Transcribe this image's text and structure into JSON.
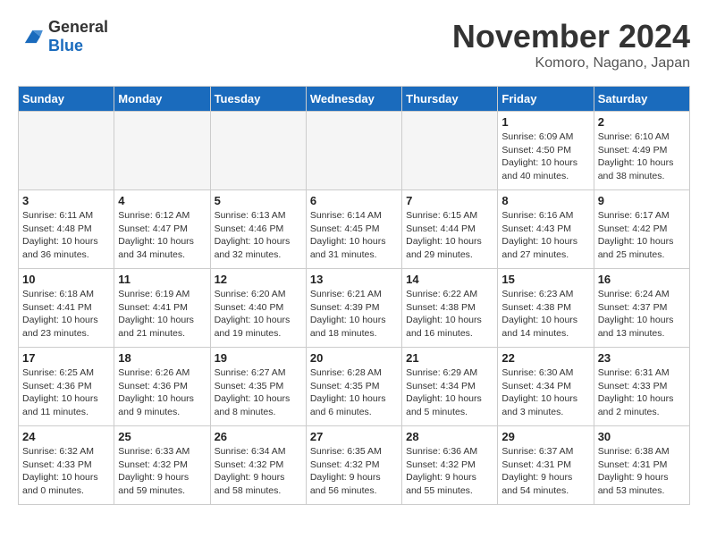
{
  "logo": {
    "general": "General",
    "blue": "Blue"
  },
  "header": {
    "month": "November 2024",
    "location": "Komoro, Nagano, Japan"
  },
  "weekdays": [
    "Sunday",
    "Monday",
    "Tuesday",
    "Wednesday",
    "Thursday",
    "Friday",
    "Saturday"
  ],
  "weeks": [
    [
      {
        "day": "",
        "info": "",
        "empty": true
      },
      {
        "day": "",
        "info": "",
        "empty": true
      },
      {
        "day": "",
        "info": "",
        "empty": true
      },
      {
        "day": "",
        "info": "",
        "empty": true
      },
      {
        "day": "",
        "info": "",
        "empty": true
      },
      {
        "day": "1",
        "info": "Sunrise: 6:09 AM\nSunset: 4:50 PM\nDaylight: 10 hours\nand 40 minutes."
      },
      {
        "day": "2",
        "info": "Sunrise: 6:10 AM\nSunset: 4:49 PM\nDaylight: 10 hours\nand 38 minutes."
      }
    ],
    [
      {
        "day": "3",
        "info": "Sunrise: 6:11 AM\nSunset: 4:48 PM\nDaylight: 10 hours\nand 36 minutes."
      },
      {
        "day": "4",
        "info": "Sunrise: 6:12 AM\nSunset: 4:47 PM\nDaylight: 10 hours\nand 34 minutes."
      },
      {
        "day": "5",
        "info": "Sunrise: 6:13 AM\nSunset: 4:46 PM\nDaylight: 10 hours\nand 32 minutes."
      },
      {
        "day": "6",
        "info": "Sunrise: 6:14 AM\nSunset: 4:45 PM\nDaylight: 10 hours\nand 31 minutes."
      },
      {
        "day": "7",
        "info": "Sunrise: 6:15 AM\nSunset: 4:44 PM\nDaylight: 10 hours\nand 29 minutes."
      },
      {
        "day": "8",
        "info": "Sunrise: 6:16 AM\nSunset: 4:43 PM\nDaylight: 10 hours\nand 27 minutes."
      },
      {
        "day": "9",
        "info": "Sunrise: 6:17 AM\nSunset: 4:42 PM\nDaylight: 10 hours\nand 25 minutes."
      }
    ],
    [
      {
        "day": "10",
        "info": "Sunrise: 6:18 AM\nSunset: 4:41 PM\nDaylight: 10 hours\nand 23 minutes."
      },
      {
        "day": "11",
        "info": "Sunrise: 6:19 AM\nSunset: 4:41 PM\nDaylight: 10 hours\nand 21 minutes."
      },
      {
        "day": "12",
        "info": "Sunrise: 6:20 AM\nSunset: 4:40 PM\nDaylight: 10 hours\nand 19 minutes."
      },
      {
        "day": "13",
        "info": "Sunrise: 6:21 AM\nSunset: 4:39 PM\nDaylight: 10 hours\nand 18 minutes."
      },
      {
        "day": "14",
        "info": "Sunrise: 6:22 AM\nSunset: 4:38 PM\nDaylight: 10 hours\nand 16 minutes."
      },
      {
        "day": "15",
        "info": "Sunrise: 6:23 AM\nSunset: 4:38 PM\nDaylight: 10 hours\nand 14 minutes."
      },
      {
        "day": "16",
        "info": "Sunrise: 6:24 AM\nSunset: 4:37 PM\nDaylight: 10 hours\nand 13 minutes."
      }
    ],
    [
      {
        "day": "17",
        "info": "Sunrise: 6:25 AM\nSunset: 4:36 PM\nDaylight: 10 hours\nand 11 minutes."
      },
      {
        "day": "18",
        "info": "Sunrise: 6:26 AM\nSunset: 4:36 PM\nDaylight: 10 hours\nand 9 minutes."
      },
      {
        "day": "19",
        "info": "Sunrise: 6:27 AM\nSunset: 4:35 PM\nDaylight: 10 hours\nand 8 minutes."
      },
      {
        "day": "20",
        "info": "Sunrise: 6:28 AM\nSunset: 4:35 PM\nDaylight: 10 hours\nand 6 minutes."
      },
      {
        "day": "21",
        "info": "Sunrise: 6:29 AM\nSunset: 4:34 PM\nDaylight: 10 hours\nand 5 minutes."
      },
      {
        "day": "22",
        "info": "Sunrise: 6:30 AM\nSunset: 4:34 PM\nDaylight: 10 hours\nand 3 minutes."
      },
      {
        "day": "23",
        "info": "Sunrise: 6:31 AM\nSunset: 4:33 PM\nDaylight: 10 hours\nand 2 minutes."
      }
    ],
    [
      {
        "day": "24",
        "info": "Sunrise: 6:32 AM\nSunset: 4:33 PM\nDaylight: 10 hours\nand 0 minutes."
      },
      {
        "day": "25",
        "info": "Sunrise: 6:33 AM\nSunset: 4:32 PM\nDaylight: 9 hours\nand 59 minutes."
      },
      {
        "day": "26",
        "info": "Sunrise: 6:34 AM\nSunset: 4:32 PM\nDaylight: 9 hours\nand 58 minutes."
      },
      {
        "day": "27",
        "info": "Sunrise: 6:35 AM\nSunset: 4:32 PM\nDaylight: 9 hours\nand 56 minutes."
      },
      {
        "day": "28",
        "info": "Sunrise: 6:36 AM\nSunset: 4:32 PM\nDaylight: 9 hours\nand 55 minutes."
      },
      {
        "day": "29",
        "info": "Sunrise: 6:37 AM\nSunset: 4:31 PM\nDaylight: 9 hours\nand 54 minutes."
      },
      {
        "day": "30",
        "info": "Sunrise: 6:38 AM\nSunset: 4:31 PM\nDaylight: 9 hours\nand 53 minutes."
      }
    ]
  ]
}
